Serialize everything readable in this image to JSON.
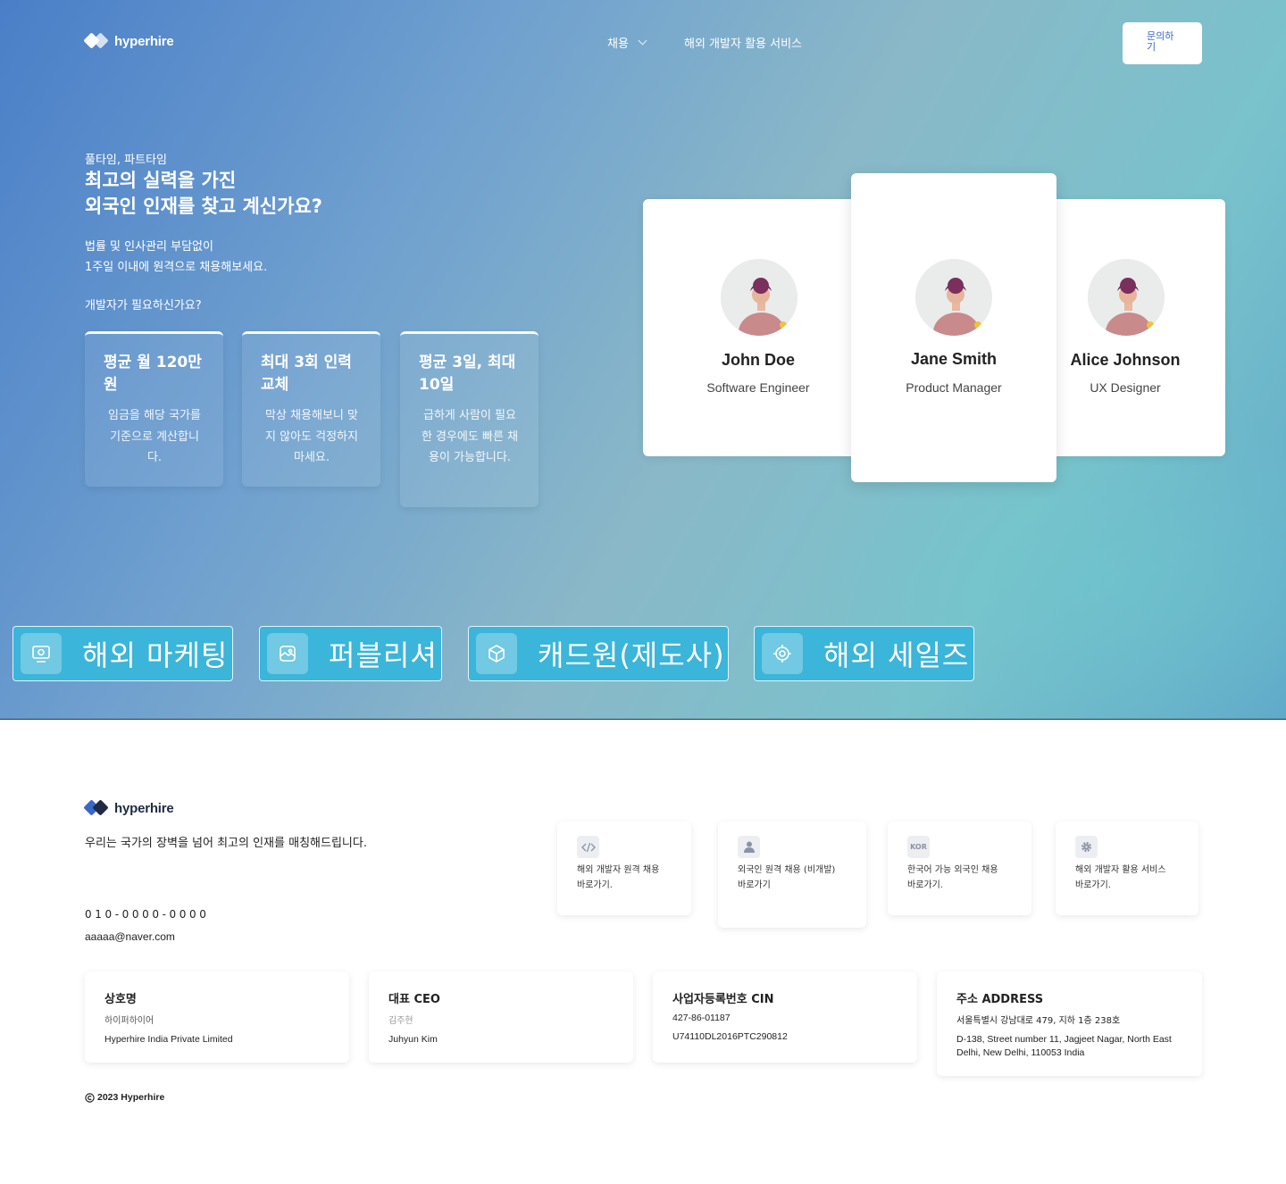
{
  "colors": {
    "brand_blue": "#3a68c8",
    "chip_bg": "#3bb5d9"
  },
  "header": {
    "logo_text": "hyperhire",
    "nav": [
      {
        "label": "채용",
        "icon": "chevron-down-icon"
      },
      {
        "label": "해외 개발자 활용 서비스"
      }
    ],
    "cta_label": "문의하기"
  },
  "hero": {
    "eyebrow": "풀타임, 파트타임",
    "title_line1": "최고의 실력을 가진",
    "title_line2": "외국인 인재를 찾고 계신가요?",
    "desc_line1": "법률 및 인사관리 부담없이",
    "desc_line2": "1주일 이내에 원격으로 채용해보세요.",
    "ask": "개발자가 필요하신가요?",
    "stats": [
      {
        "title": "평균 월 120만원",
        "desc": "임금을 해당 국가를 기준으로 계산합니다."
      },
      {
        "title": "최대 3회 인력교체",
        "desc": "막상 채용해보니 맞지 않아도 걱정하지 마세요."
      },
      {
        "title": "평균 3일, 최대 10일",
        "desc": "급하게 사람이 필요한 경우에도 빠른 채용이 가능합니다."
      }
    ]
  },
  "profiles": [
    {
      "name": "John Doe",
      "role": "Software Engineer"
    },
    {
      "name": "Jane Smith",
      "role": "Product Manager"
    },
    {
      "name": "Alice Johnson",
      "role": "UX Designer"
    }
  ],
  "categories": [
    {
      "label": "해외 마케팅",
      "icon": "marketing-icon"
    },
    {
      "label": "퍼블리셔",
      "icon": "image-icon"
    },
    {
      "label": "캐드원(제도사)",
      "icon": "box-icon"
    },
    {
      "label": "해외 세일즈",
      "icon": "target-icon"
    }
  ],
  "footer": {
    "logo_text": "hyperhire",
    "tagline": "우리는 국가의 장벽을 넘어 최고의 인재를 매칭해드립니다.",
    "phone": "010-0000-0000",
    "email": "aaaaa@naver.com",
    "services": [
      {
        "icon": "code-icon",
        "label": "해외 개발자 원격 채용",
        "link": "바로가기."
      },
      {
        "icon": "person-icon",
        "label": "외국인 원격 채용 (비개발)",
        "link": "바로가기"
      },
      {
        "icon": "kor-badge-icon",
        "icon_text": "KOR",
        "label": "한국어 가능 외국인 채용",
        "link": "바로가기."
      },
      {
        "icon": "gear-icon",
        "label": "해외 개발자 활용 서비스",
        "link": "바로가기."
      }
    ],
    "info": [
      {
        "title": "상호명",
        "ko": "하이퍼하이어",
        "en": "Hyperhire India Private Limited"
      },
      {
        "title": "대표 CEO",
        "ko": "김주현",
        "en": "Juhyun Kim"
      },
      {
        "title": "사업자등록번호 CIN",
        "ko": "427-86-01187",
        "en": "U74110DL2016PTC290812"
      },
      {
        "title": "주소 ADDRESS",
        "ko": "서울특별시 강남대로 479, 지하 1층 238호",
        "en": "D-138, Street number 11, Jagjeet Nagar, North East Delhi, New Delhi, 110053 India"
      }
    ],
    "copyright": "2023 Hyperhire"
  }
}
